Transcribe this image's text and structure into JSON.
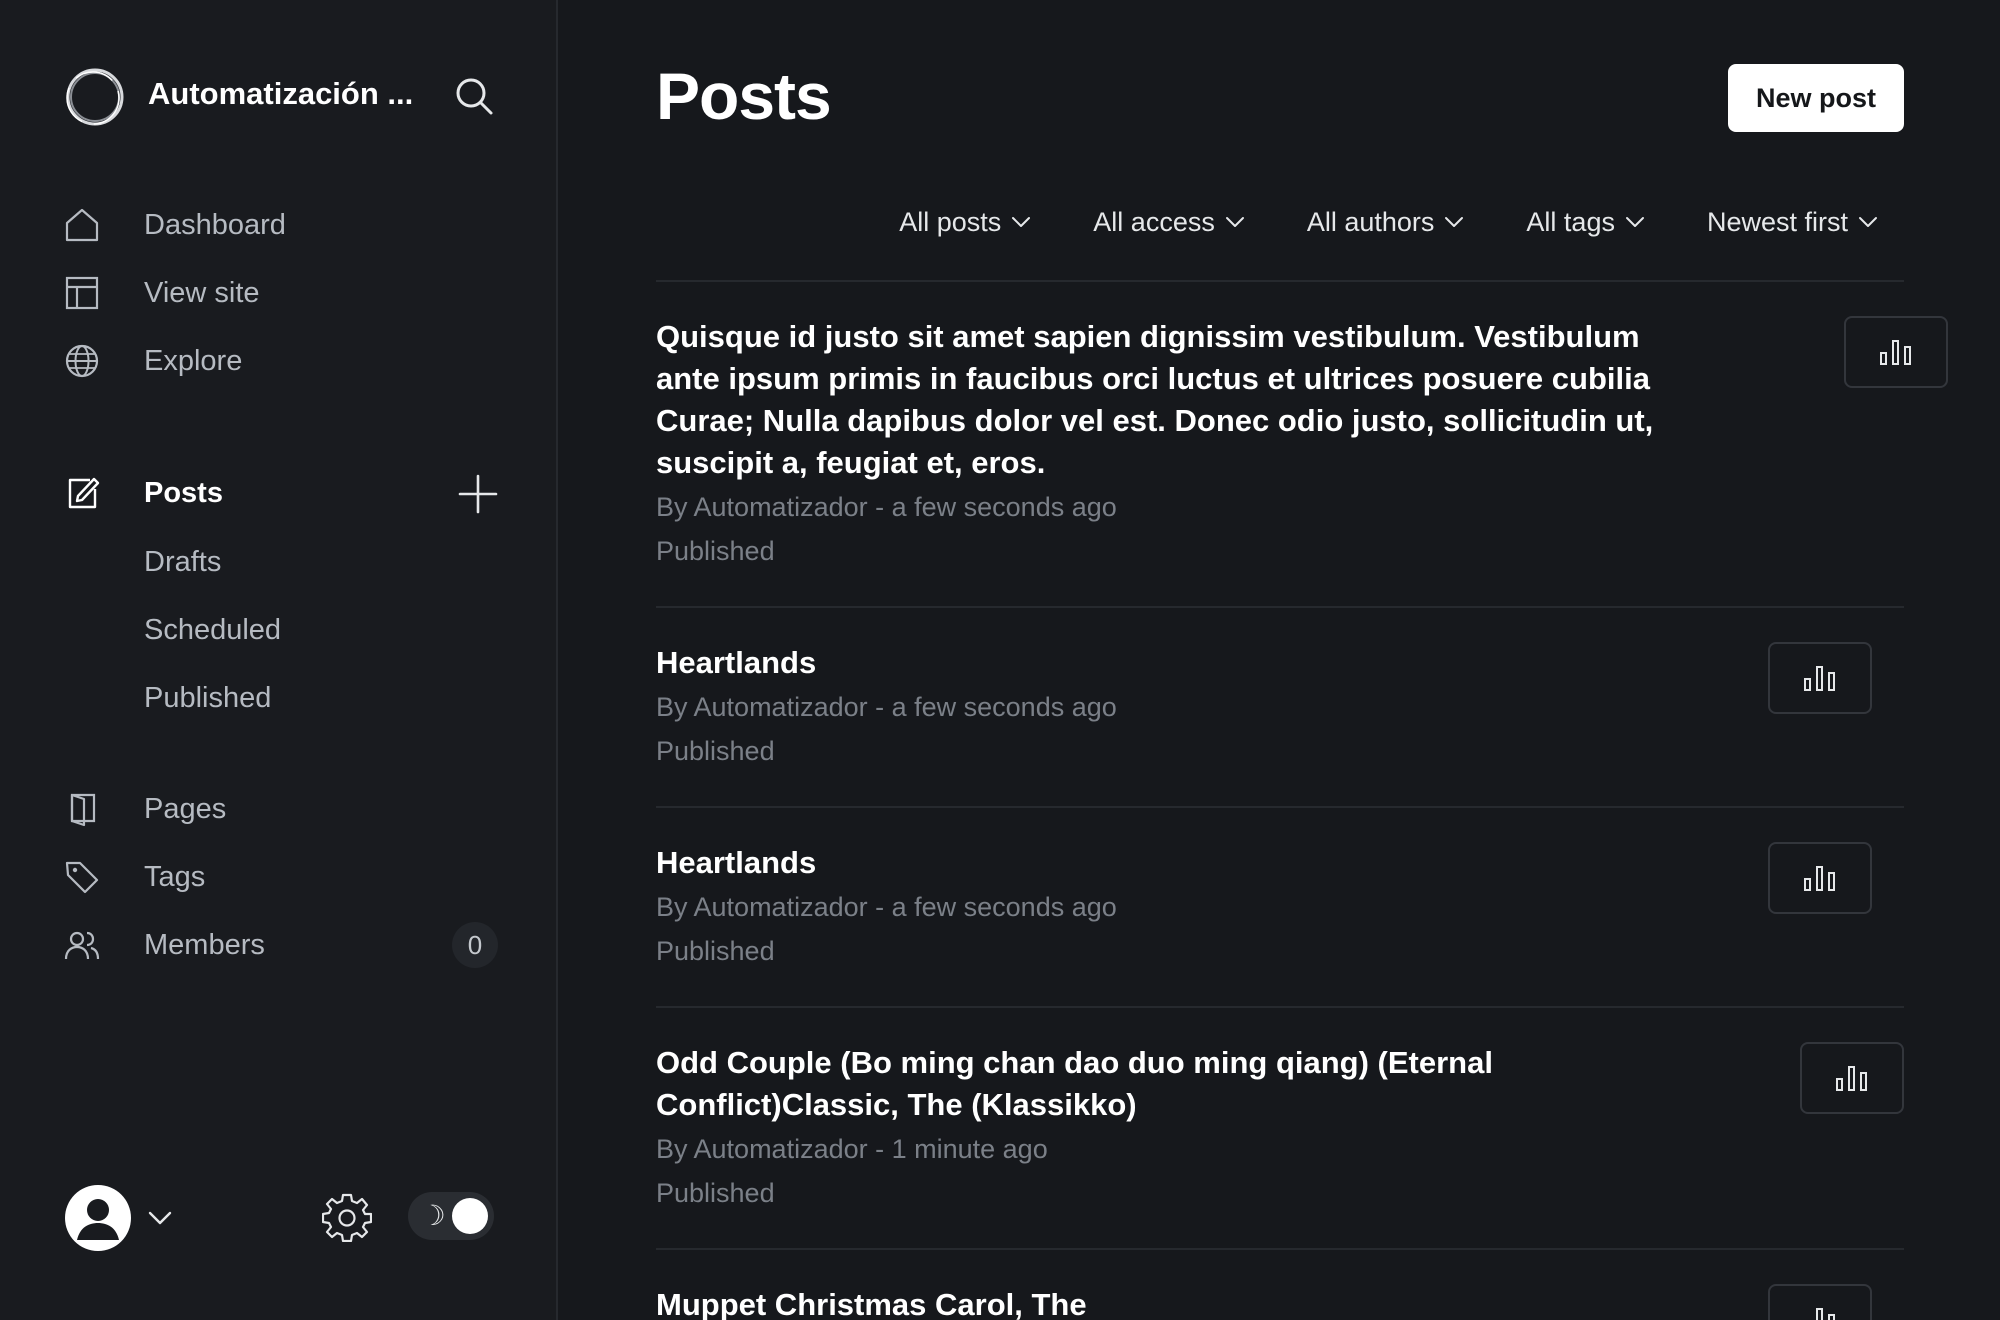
{
  "sidebar": {
    "site_name": "Automatización ...",
    "nav": [
      {
        "label": "Dashboard",
        "icon": "home-icon"
      },
      {
        "label": "View site",
        "icon": "layout-icon"
      },
      {
        "label": "Explore",
        "icon": "globe-icon"
      }
    ],
    "posts": {
      "label": "Posts",
      "icon": "edit-icon",
      "subitems": [
        "Drafts",
        "Scheduled",
        "Published"
      ]
    },
    "nav2": [
      {
        "label": "Pages",
        "icon": "page-icon"
      },
      {
        "label": "Tags",
        "icon": "tag-icon"
      },
      {
        "label": "Members",
        "icon": "members-icon",
        "count": "0"
      }
    ],
    "theme": "dark"
  },
  "header": {
    "title": "Posts",
    "new_post_label": "New post"
  },
  "filters": [
    "All posts",
    "All access",
    "All authors",
    "All tags",
    "Newest first"
  ],
  "posts": [
    {
      "title": "Quisque id justo sit amet sapien dignissim vestibulum. Vestibulum ante ipsum primis in faucibus orci luctus et ultrices posuere cubilia Curae; Nulla dapibus dolor vel est. Donec odio justo, sollicitudin ut, suscipit a, feugiat et, eros.",
      "meta": "By Automatizador - a few seconds ago",
      "status": "Published"
    },
    {
      "title": "Heartlands",
      "meta": "By Automatizador - a few seconds ago",
      "status": "Published"
    },
    {
      "title": "Heartlands",
      "meta": "By Automatizador - a few seconds ago",
      "status": "Published"
    },
    {
      "title": "Odd Couple (Bo ming chan dao duo ming qiang) (Eternal Conflict)Classic, The (Klassikko)",
      "meta": "By Automatizador - 1 minute ago",
      "status": "Published"
    },
    {
      "title": "Muppet Christmas Carol, The",
      "meta": "",
      "status": ""
    }
  ],
  "colors": {
    "background": "#16181c",
    "sidebar": "#191b1f",
    "text": "#ffffff",
    "muted": "#7b8088",
    "divider": "#26292e"
  }
}
